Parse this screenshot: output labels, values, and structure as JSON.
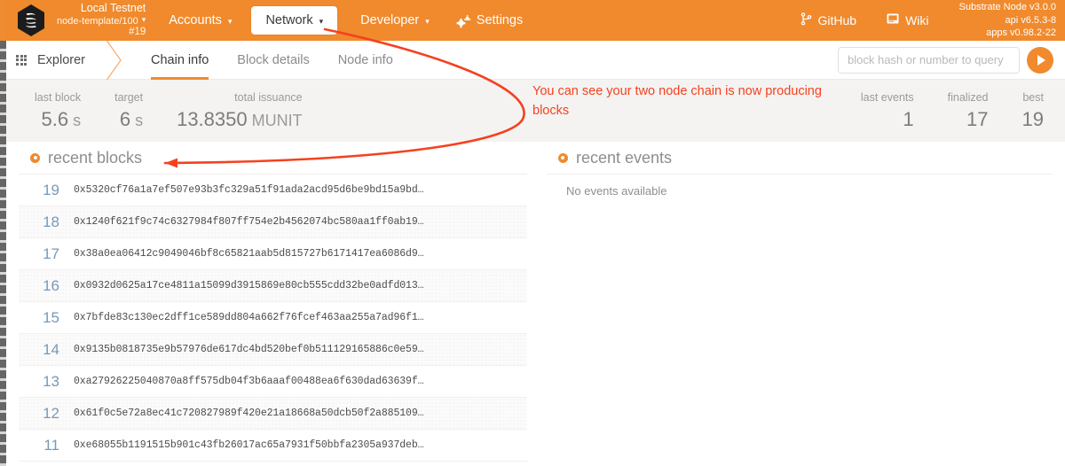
{
  "topbar": {
    "logo_icon": "substrate-hexagon-logo",
    "chain": {
      "name": "Local Testnet",
      "endpoint": "node-template/100",
      "block": "#19",
      "caret": "▾"
    },
    "nav": [
      {
        "id": "accounts",
        "label": "Accounts",
        "caret": "▾",
        "active": false
      },
      {
        "id": "network",
        "label": "Network",
        "caret": "▾",
        "active": true
      },
      {
        "id": "developer",
        "label": "Developer",
        "caret": "▾",
        "active": false
      },
      {
        "id": "settings",
        "label": "Settings",
        "caret": "",
        "active": false,
        "icon": "gear-icon"
      }
    ],
    "links": [
      {
        "id": "github",
        "label": "GitHub",
        "icon": "git-branch-icon"
      },
      {
        "id": "wiki",
        "label": "Wiki",
        "icon": "book-icon"
      }
    ],
    "versions": {
      "node": "Substrate Node v3.0.0",
      "api": "api v6.5.3-8",
      "apps": "apps v0.98.2-22"
    },
    "accent": "#f08a2d"
  },
  "tabs": {
    "section": {
      "label": "Explorer",
      "icon": "grid-dots-icon"
    },
    "items": [
      {
        "id": "chain-info",
        "label": "Chain info",
        "active": true
      },
      {
        "id": "block-details",
        "label": "Block details",
        "active": false
      },
      {
        "id": "node-info",
        "label": "Node info",
        "active": false
      }
    ],
    "search": {
      "value": "",
      "placeholder": "block hash or number to query",
      "submit_icon": "play-icon"
    }
  },
  "summary": {
    "left": [
      {
        "label": "last block",
        "value": "5.6",
        "unit": " s"
      },
      {
        "label": "target",
        "value": "6",
        "unit": " s"
      },
      {
        "label": "total issuance",
        "value": "13.8350",
        "unit": " MUNIT"
      }
    ],
    "right": [
      {
        "label": "last events",
        "value": "1",
        "unit": ""
      },
      {
        "label": "finalized",
        "value": "17",
        "unit": ""
      },
      {
        "label": "best",
        "value": "19",
        "unit": ""
      }
    ]
  },
  "annotation": {
    "text": "You can see your two node chain is now producing blocks",
    "color": "#f4421f"
  },
  "recent_blocks": {
    "title": "recent blocks",
    "icon": "orange-dot-icon",
    "rows": [
      {
        "number": "19",
        "hash": "0x5320cf76a1a7ef507e93b3fc329a51f91ada2acd95d6be9bd15a9bd…"
      },
      {
        "number": "18",
        "hash": "0x1240f621f9c74c6327984f807ff754e2b4562074bc580aa1ff0ab19…"
      },
      {
        "number": "17",
        "hash": "0x38a0ea06412c9049046bf8c65821aab5d815727b6171417ea6086d9…"
      },
      {
        "number": "16",
        "hash": "0x0932d0625a17ce4811a15099d3915869e80cb555cdd32be0adfd013…"
      },
      {
        "number": "15",
        "hash": "0x7bfde83c130ec2dff1ce589dd804a662f76fcef463aa255a7ad96f1…"
      },
      {
        "number": "14",
        "hash": "0x9135b0818735e9b57976de617dc4bd520bef0b511129165886c0e59…"
      },
      {
        "number": "13",
        "hash": "0xa27926225040870a8ff575db04f3b6aaaf00488ea6f630dad63639f…"
      },
      {
        "number": "12",
        "hash": "0x61f0c5e72a8ec41c720827989f420e21a18668a50dcb50f2a885109…"
      },
      {
        "number": "11",
        "hash": "0xe68055b1191515b901c43fb26017ac65a7931f50bbfa2305a937deb…"
      }
    ]
  },
  "recent_events": {
    "title": "recent events",
    "icon": "orange-dot-icon",
    "empty_text": "No events available"
  }
}
